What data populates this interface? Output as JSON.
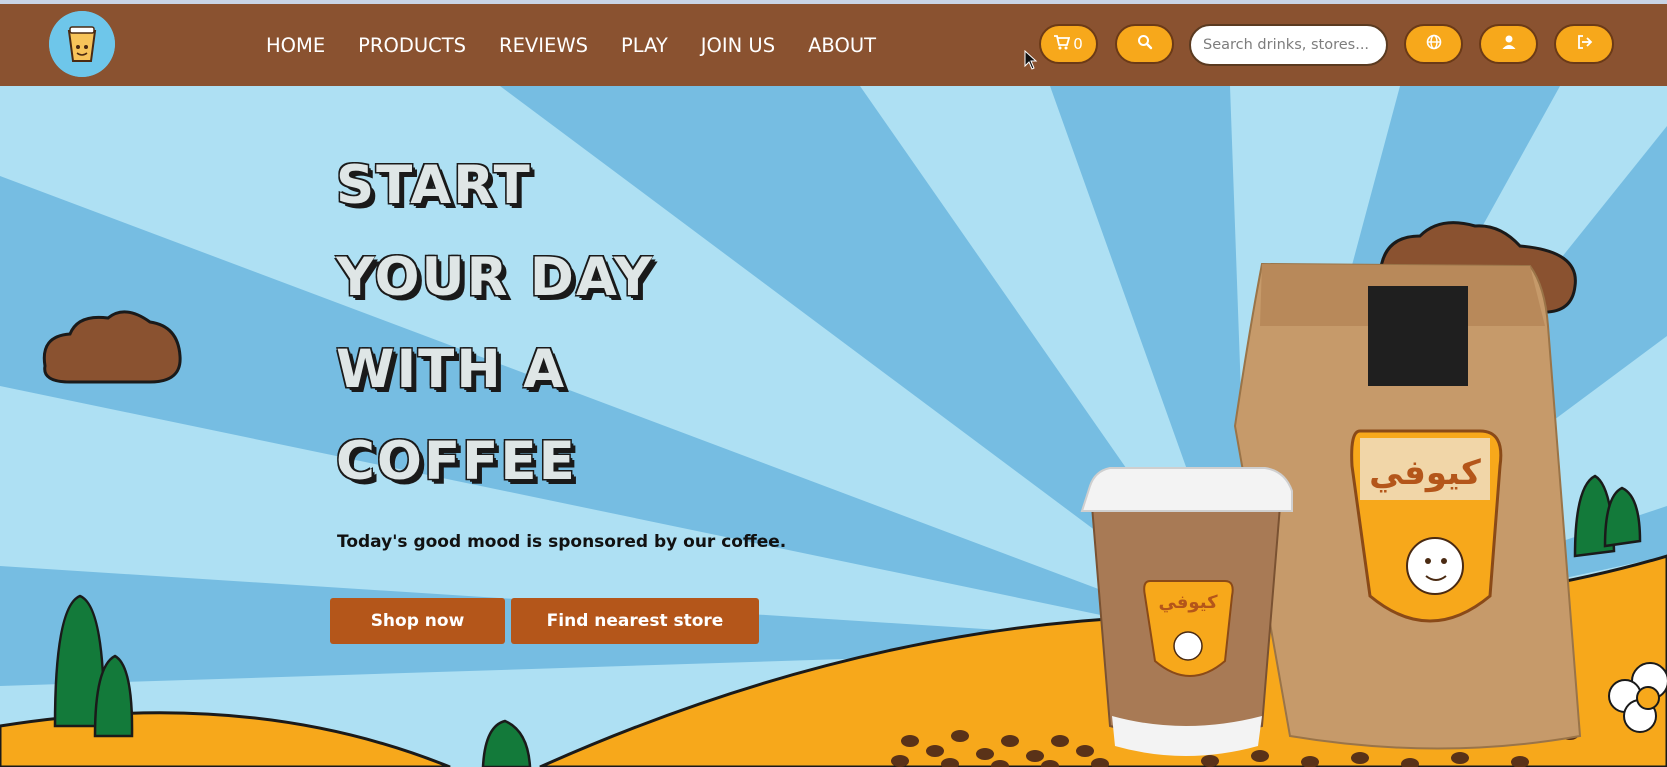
{
  "nav": {
    "links": [
      "HOME",
      "PRODUCTS",
      "REVIEWS",
      "PLAY",
      "JOIN US",
      "ABOUT"
    ],
    "cart_count": "0",
    "search_placeholder": "Search drinks, stores..."
  },
  "hero": {
    "headline": [
      "START",
      "YOUR DAY",
      "WITH A",
      "COFFEE"
    ],
    "tagline": "Today's good mood is sponsored by our coffee.",
    "shop_label": "Shop now",
    "store_label": "Find nearest store",
    "brand_arabic": "كيوفي"
  },
  "colors": {
    "navbar": "#8a5230",
    "accent": "#f7a81b",
    "cta": "#b4561a",
    "sky": "#8fcfe8",
    "hill": "#f7a81b"
  },
  "icons": [
    "logo-icon",
    "cart-icon",
    "search-icon",
    "globe-icon",
    "user-icon",
    "logout-icon"
  ]
}
